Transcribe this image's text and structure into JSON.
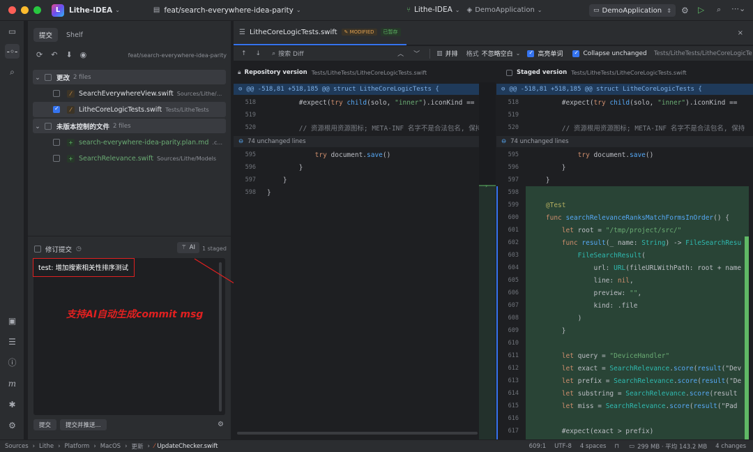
{
  "titlebar": {
    "project": "Lithe-IDEA",
    "branch": "feat/search-everywhere-idea-parity",
    "center_project": "Lithe-IDEA",
    "center_config": "DemoApplication",
    "run_config": "DemoApplication"
  },
  "left": {
    "tab_commit": "提交",
    "tab_shelf": "Shelf",
    "branch": "feat/search-everywhere-idea-parity",
    "changes_group": {
      "label": "更改",
      "count": "2 files"
    },
    "changes": [
      {
        "name": "SearchEverywhereView.swift",
        "path": "Sources/Lithe/...",
        "checked": false
      },
      {
        "name": "LitheCoreLogicTests.swift",
        "path": "Tests/LitheTests",
        "checked": true
      }
    ],
    "unversioned_group": {
      "label": "未版本控制的文件",
      "count": "2 files"
    },
    "unversioned": [
      {
        "name": "search-everywhere-idea-parity.plan.md",
        "path": ".c..."
      },
      {
        "name": "SearchRelevance.swift",
        "path": "Sources/Lithe/Models"
      }
    ],
    "amend_label": "修订提交",
    "ai_label": "AI",
    "staged_count": "1 staged",
    "commit_message": "test: 增加搜索相关性排序测试",
    "annotation": "支持AI自动生成commit msg",
    "commit_button": "提交",
    "commit_push_button": "提交并推送..."
  },
  "editor": {
    "tab_file": "LitheCoreLogicTests.swift",
    "badge_modified": "MODIFIED",
    "badge_staged": "已暂存",
    "search_placeholder": "搜索 Diff",
    "side_by_side": "并排",
    "format_label": "格式",
    "whitespace_option": "不忽略空白",
    "highlight_words": "高亮单词",
    "collapse_unchanged": "Collapse unchanged",
    "path_right": "Tests/LitheTests/LitheCoreLogicTe",
    "left_pane_title": "Repository version",
    "left_pane_path": "Tests/LitheTests/LitheCoreLogicTests.swift",
    "right_pane_title": "Staged version",
    "right_pane_path": "Tests/LitheTests/LitheCoreLogicTests.swift",
    "hunk_header": "@@ -518,81 +518,185 @@ struct LitheCoreLogicTests {",
    "unchanged_lines": "74 unchanged lines",
    "top_lines": [
      {
        "n": "518",
        "t": "        #expect(try child(solo, \"inner\").iconKind =="
      },
      {
        "n": "519",
        "t": ""
      },
      {
        "n": "520",
        "t": "        // 资源根用资源图标; META-INF 名字不是合法包名, 保持"
      }
    ],
    "mid_lines": [
      {
        "n": "595",
        "t": "            try document.save()"
      },
      {
        "n": "596",
        "t": "        }"
      },
      {
        "n": "597",
        "t": "    }"
      }
    ],
    "left_last_line": {
      "n": "598",
      "t": "}"
    },
    "added_lines": [
      {
        "n": "598",
        "t": ""
      },
      {
        "n": "599",
        "t": "    @Test"
      },
      {
        "n": "600",
        "t": "    func searchRelevanceRanksMatchFormsInOrder() {"
      },
      {
        "n": "601",
        "t": "        let root = \"/tmp/project/src/\""
      },
      {
        "n": "602",
        "t": "        func result(_ name: String) -> FileSearchResu"
      },
      {
        "n": "603",
        "t": "            FileSearchResult("
      },
      {
        "n": "604",
        "t": "                url: URL(fileURLWithPath: root + name"
      },
      {
        "n": "605",
        "t": "                line: nil,"
      },
      {
        "n": "606",
        "t": "                preview: \"\","
      },
      {
        "n": "607",
        "t": "                kind: .file"
      },
      {
        "n": "608",
        "t": "            )"
      },
      {
        "n": "609",
        "t": "        }"
      },
      {
        "n": "610",
        "t": ""
      },
      {
        "n": "611",
        "t": "        let query = \"DeviceHandler\""
      },
      {
        "n": "612",
        "t": "        let exact = SearchRelevance.score(result(\"Dev"
      },
      {
        "n": "613",
        "t": "        let prefix = SearchRelevance.score(result(\"De"
      },
      {
        "n": "614",
        "t": "        let substring = SearchRelevance.score(result"
      },
      {
        "n": "615",
        "t": "        let miss = SearchRelevance.score(result(\"Pad"
      },
      {
        "n": "616",
        "t": ""
      },
      {
        "n": "617",
        "t": "        #expect(exact > prefix)"
      }
    ]
  },
  "statusbar": {
    "crumbs": [
      "Sources",
      "Lithe",
      "Platform",
      "MacOS",
      "更新",
      "UpdateChecker.swift"
    ],
    "position": "609:1",
    "encoding": "UTF-8",
    "indent": "4 spaces",
    "memory": "299 MB · 平均 143.2 MB",
    "changes": "4 changes"
  },
  "colors": {
    "accent": "#3574f0",
    "annotation": "#e02020",
    "added_bg": "#294436"
  }
}
